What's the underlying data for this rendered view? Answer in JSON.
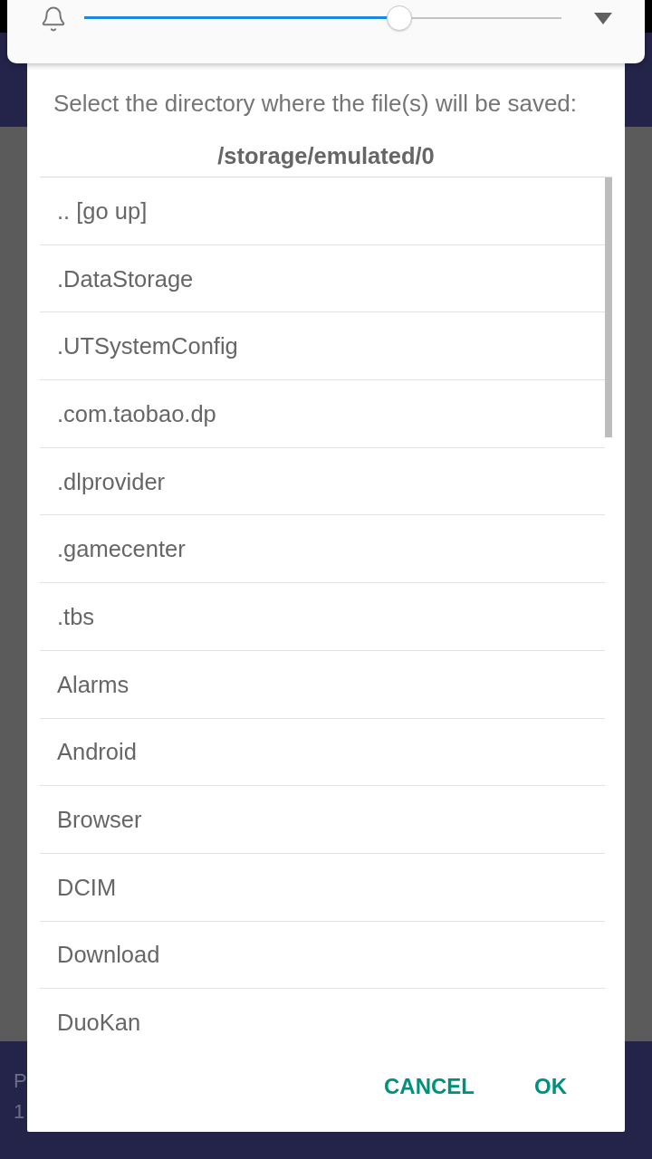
{
  "volume_panel": {
    "slider": {
      "level": 0.66
    }
  },
  "dialog": {
    "message": "Select the directory where the file(s) will be saved:",
    "path": "/storage/emulated/0",
    "directories": [
      ".. [go up]",
      ".DataStorage",
      ".UTSystemConfig",
      ".com.taobao.dp",
      ".dlprovider",
      ".gamecenter",
      ".tbs",
      "Alarms",
      "Android",
      "Browser",
      "DCIM",
      "Download",
      "DuoKan"
    ],
    "buttons": [
      {
        "label": "CANCEL"
      },
      {
        "label": "OK"
      }
    ]
  },
  "background": {
    "bottom_panel": {
      "lines": [
        "P",
        "1"
      ]
    }
  }
}
